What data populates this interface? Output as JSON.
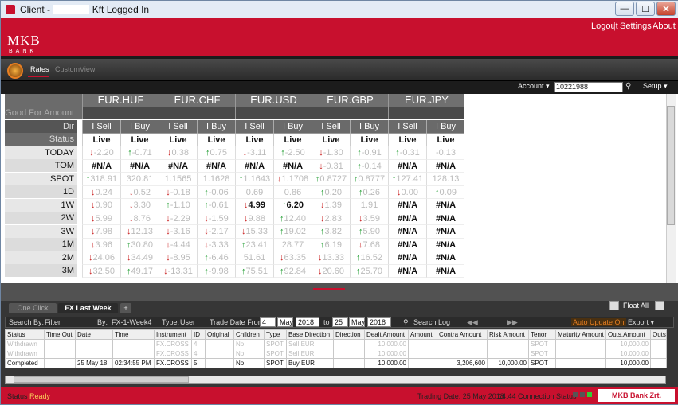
{
  "window": {
    "title_prefix": "Client - ",
    "title_suffix": "Kft Logged In",
    "min": "—",
    "max": "☐",
    "close": "✕"
  },
  "topnav": {
    "logout": "Logout",
    "settings": "Settings",
    "about": "About",
    "brand": "MKB",
    "brand_sub": "BANK"
  },
  "tabs": {
    "rates": "Rates",
    "custom_view": "CustomView"
  },
  "account": {
    "label": "Account ▾",
    "value": "10221988",
    "setup": "Setup ▾"
  },
  "rates": {
    "row_labels": [
      "Good For Amount",
      "Dir",
      "Status",
      "TODAY",
      "TOM",
      "SPOT",
      "1D",
      "1W",
      "2W",
      "3W",
      "1M",
      "2M",
      "3M"
    ],
    "currencies": [
      "EUR.HUF",
      "EUR.CHF",
      "EUR.USD",
      "EUR.GBP",
      "EUR.JPY"
    ],
    "sell_label": "I Sell",
    "buy_label": "I Buy",
    "status_value": "Live",
    "rows": [
      [
        [
          "dn",
          "-2.20"
        ],
        [
          "up",
          "-0.71"
        ],
        [
          "dn",
          "0.38"
        ],
        [
          "up",
          "0.75"
        ],
        [
          "dn",
          "-3.11"
        ],
        [
          "up",
          "-2.50"
        ],
        [
          "dn",
          "-1.30"
        ],
        [
          "up",
          "-0.91"
        ],
        [
          "up",
          "-0.31"
        ],
        [
          "",
          "-0.13"
        ]
      ],
      [
        [
          "na",
          "#N/A"
        ],
        [
          "na",
          "#N/A"
        ],
        [
          "na",
          "#N/A"
        ],
        [
          "na",
          "#N/A"
        ],
        [
          "na",
          "#N/A"
        ],
        [
          "na",
          "#N/A"
        ],
        [
          "dn",
          "-0.31"
        ],
        [
          "up",
          "-0.14"
        ],
        [
          "na",
          "#N/A"
        ],
        [
          "na",
          "#N/A"
        ]
      ],
      [
        [
          "up",
          "318.91"
        ],
        [
          "",
          "320.81"
        ],
        [
          "",
          "1.1565"
        ],
        [
          "",
          "1.1628"
        ],
        [
          "up",
          "1.1643"
        ],
        [
          "dn",
          "1.1708"
        ],
        [
          "up",
          "0.8727"
        ],
        [
          "up",
          "0.8777"
        ],
        [
          "up",
          "127.41"
        ],
        [
          "",
          "128.13"
        ]
      ],
      [
        [
          "dn",
          "0.24"
        ],
        [
          "dn",
          "0.52"
        ],
        [
          "dn",
          "-0.18"
        ],
        [
          "up",
          "-0.06"
        ],
        [
          "",
          "0.69"
        ],
        [
          "",
          "0.86"
        ],
        [
          "up",
          "0.20"
        ],
        [
          "up",
          "0.26"
        ],
        [
          "dn",
          "0.00"
        ],
        [
          "up",
          "0.09"
        ]
      ],
      [
        [
          "dn",
          "0.90"
        ],
        [
          "dn",
          "3.30"
        ],
        [
          "up",
          "-1.10"
        ],
        [
          "up",
          "-0.61"
        ],
        [
          "dnb",
          "4.99"
        ],
        [
          "upb",
          "6.20"
        ],
        [
          "dn",
          "1.39"
        ],
        [
          "",
          "1.91"
        ],
        [
          "na",
          "#N/A"
        ],
        [
          "na",
          "#N/A"
        ]
      ],
      [
        [
          "dn",
          "5.99"
        ],
        [
          "dn",
          "8.76"
        ],
        [
          "dn",
          "-2.29"
        ],
        [
          "dn",
          "-1.59"
        ],
        [
          "dn",
          "9.88"
        ],
        [
          "up",
          "12.40"
        ],
        [
          "dn",
          "2.83"
        ],
        [
          "dn",
          "3.59"
        ],
        [
          "na",
          "#N/A"
        ],
        [
          "na",
          "#N/A"
        ]
      ],
      [
        [
          "dn",
          "7.98"
        ],
        [
          "dn",
          "12.13"
        ],
        [
          "dn",
          "-3.16"
        ],
        [
          "dn",
          "-2.17"
        ],
        [
          "dn",
          "15.33"
        ],
        [
          "up",
          "19.02"
        ],
        [
          "up",
          "3.82"
        ],
        [
          "up",
          "5.90"
        ],
        [
          "na",
          "#N/A"
        ],
        [
          "na",
          "#N/A"
        ]
      ],
      [
        [
          "dn",
          "3.96"
        ],
        [
          "up",
          "30.80"
        ],
        [
          "dn",
          "-4.44"
        ],
        [
          "dn",
          "-3.33"
        ],
        [
          "up",
          "23.41"
        ],
        [
          "",
          "28.77"
        ],
        [
          "up",
          "6.19"
        ],
        [
          "dn",
          "7.68"
        ],
        [
          "na",
          "#N/A"
        ],
        [
          "na",
          "#N/A"
        ]
      ],
      [
        [
          "dn",
          "24.06"
        ],
        [
          "dn",
          "34.49"
        ],
        [
          "dn",
          "-8.95"
        ],
        [
          "up",
          "-6.46"
        ],
        [
          "",
          "51.61"
        ],
        [
          "dn",
          "63.35"
        ],
        [
          "dn",
          "13.33"
        ],
        [
          "up",
          "16.52"
        ],
        [
          "na",
          "#N/A"
        ],
        [
          "na",
          "#N/A"
        ]
      ],
      [
        [
          "dn",
          "32.50"
        ],
        [
          "up",
          "49.17"
        ],
        [
          "dn",
          "-13.31"
        ],
        [
          "up",
          "-9.98"
        ],
        [
          "up",
          "75.51"
        ],
        [
          "up",
          "92.84"
        ],
        [
          "dn",
          "20.60"
        ],
        [
          "up",
          "25.70"
        ],
        [
          "na",
          "#N/A"
        ],
        [
          "na",
          "#N/A"
        ]
      ]
    ]
  },
  "bottom": {
    "tab_oneclick": "One Click",
    "tab_fx": "FX Last Week",
    "tab_add": "+",
    "float_all": "Float All",
    "search_by": "Search By:",
    "search_by_val": "Filter",
    "by": "By:",
    "by_val": "FX-1-Week4",
    "type": "Type:",
    "type_val": "User",
    "trade_from": "Trade Date From:",
    "d1": "4",
    "m1": "May",
    "y1": "2018",
    "to": "to",
    "d2": "25",
    "m2": "May",
    "y2": "2018",
    "search_log": "Search Log",
    "auto_update": "Auto Update On",
    "export": "Export ▾",
    "columns": [
      "Status",
      "Time Out",
      "Date",
      "Time",
      "Instrument",
      "ID",
      "Original",
      "Children",
      "Type",
      "Base Direction",
      "Direction",
      "Dealt Amount",
      "Amount",
      "Contra Amount",
      "Risk Amount",
      "Tenor",
      "Maturity Amount",
      "Outs.Amount",
      "Outs"
    ],
    "rows": [
      [
        "Withdrawn",
        "",
        "",
        "",
        "FX.CROSS",
        "4",
        "",
        "No",
        "SPOT",
        "Sell EUR",
        "",
        "10,000.00",
        "",
        "",
        "",
        "SPOT",
        "",
        "10,000.00",
        ""
      ],
      [
        "Withdrawn",
        "",
        "",
        "",
        "FX.CROSS",
        "4",
        "",
        "No",
        "SPOT",
        "Sell EUR",
        "",
        "10,000.00",
        "",
        "",
        "",
        "SPOT",
        "",
        "10,000.00",
        ""
      ],
      [
        "Completed",
        "",
        "25 May 18",
        "02:34:55 PM",
        "FX.CROSS",
        "5",
        "",
        "No",
        "SPOT",
        "Buy EUR",
        "",
        "10,000.00",
        "",
        "3,206,600",
        "10,000.00",
        "SPOT",
        "",
        "10,000.00",
        ""
      ]
    ]
  },
  "status": {
    "label": "Status",
    "value": "Ready",
    "trading": "Trading Date: 25 May 2018",
    "time": "14:44",
    "conn": "Connection Status",
    "company": "MKB Bank Zrt."
  },
  "colors": {
    "brand": "#c8102e",
    "up": "#1a9a2a",
    "down": "#c81d1d"
  }
}
